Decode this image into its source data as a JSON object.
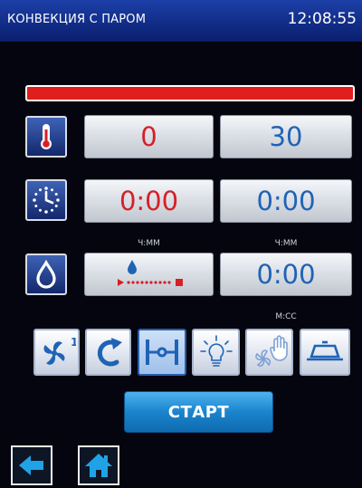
{
  "header": {
    "mode_title": "КОНВЕКЦИЯ С ПАРОМ",
    "time": "12:08:55"
  },
  "progress": {
    "fraction": 1.0,
    "color": "#e01e1e"
  },
  "temperature_row": {
    "icon": "thermometer-icon",
    "actual_value": "0",
    "set_value": "30"
  },
  "timer_row": {
    "icon": "clock-icon",
    "elapsed": "0:00",
    "set": "0:00",
    "unit_left": "Ч:ММ",
    "unit_right": "Ч:ММ"
  },
  "steam_row": {
    "icon": "water-drop-icon",
    "steam_level_icon": "steam-level-indicator",
    "duration": "0:00",
    "unit": "М:СС"
  },
  "function_buttons": [
    {
      "name": "fan-speed-button",
      "icon": "fan-icon",
      "badge": "1"
    },
    {
      "name": "reverse-button",
      "icon": "reverse-arrow-icon"
    },
    {
      "name": "damper-button",
      "icon": "damper-icon",
      "active": true
    },
    {
      "name": "light-button",
      "icon": "light-bulb-icon"
    },
    {
      "name": "manual-fan-button",
      "icon": "hand-fan-icon"
    },
    {
      "name": "tray-button",
      "icon": "tray-icon"
    }
  ],
  "start_label": "СТАРТ",
  "nav": {
    "back_icon": "arrow-left-icon",
    "home_icon": "home-icon"
  },
  "colors": {
    "red_value": "#d61f26",
    "blue_value": "#1f63b5",
    "accent": "#1a84cd"
  }
}
